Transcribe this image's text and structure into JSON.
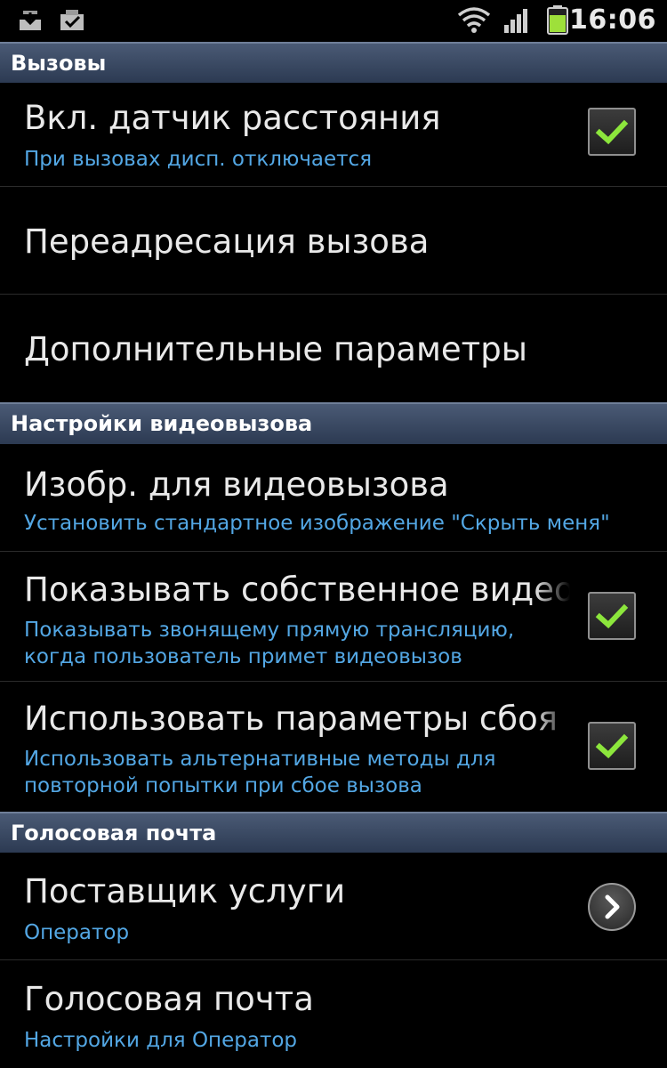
{
  "status_bar": {
    "time": "16:06",
    "icons": [
      "download-icon",
      "task-check-icon",
      "wifi-icon",
      "signal-icon",
      "battery-icon"
    ],
    "battery_color": "#9ee03a"
  },
  "colors": {
    "section_header": "#3b4a66",
    "summary_text": "#53a7e4",
    "check_mark": "#8ce63c"
  },
  "sections": [
    {
      "title": "Вызовы"
    },
    {
      "title": "Настройки видеовызова"
    },
    {
      "title": "Голосовая почта"
    }
  ],
  "items": [
    {
      "title": "Вкл. датчик расстояния",
      "summary": "При вызовах дисп. отключается",
      "checked": true
    },
    {
      "title": "Переадресация вызова"
    },
    {
      "title": "Дополнительные параметры"
    },
    {
      "title": "Изобр. для видеовызова",
      "summary": "Установить стандартное изображение \"Скрыть меня\""
    },
    {
      "title": "Показывать собственное видео",
      "summary_line1": "Показывать звонящему прямую трансляцию,",
      "summary_line2": "когда пользователь примет видеовызов",
      "checked": true
    },
    {
      "title": "Использовать параметры сбоя при вызове",
      "summary_line1": "Использовать альтернативные методы для",
      "summary_line2": "повторной попытки при сбое вызова",
      "checked": true
    },
    {
      "title": "Поставщик услуги",
      "summary": "Оператор",
      "control": "chevron-right-icon"
    },
    {
      "title": "Голосовая почта",
      "summary": "Настройки для Оператор"
    }
  ]
}
